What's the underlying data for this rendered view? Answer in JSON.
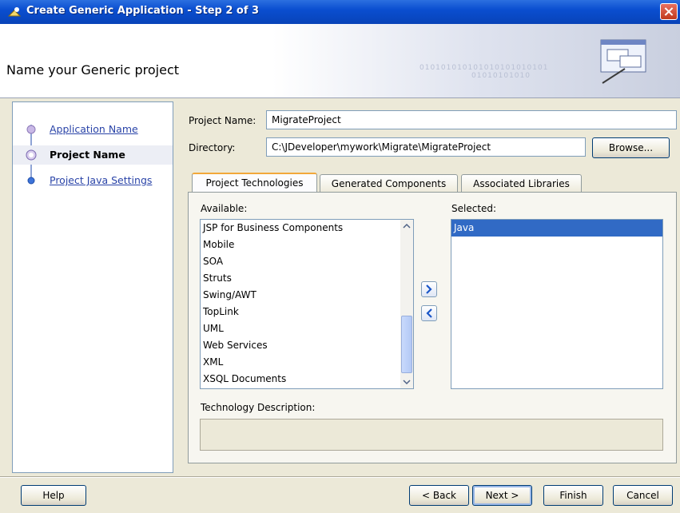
{
  "window": {
    "title": "Create Generic Application - Step 2 of 3"
  },
  "header": {
    "title": "Name your Generic project",
    "binary": "010101010101010101010101",
    "binary2": "01010101010"
  },
  "nav": {
    "items": [
      {
        "label": "Application Name",
        "state": "link"
      },
      {
        "label": "Project Name",
        "state": "current"
      },
      {
        "label": "Project Java Settings",
        "state": "link"
      }
    ]
  },
  "form": {
    "project_name_label": "Project Name:",
    "project_name_value": "MigrateProject",
    "directory_label": "Directory:",
    "directory_value": "C:\\JDeveloper\\mywork\\Migrate\\MigrateProject",
    "browse_label": "Browse..."
  },
  "tabs": [
    {
      "label": "Project Technologies",
      "active": true
    },
    {
      "label": "Generated Components",
      "active": false
    },
    {
      "label": "Associated Libraries",
      "active": false
    }
  ],
  "available": {
    "label": "Available:",
    "items": [
      "JSP for Business Components",
      "Mobile",
      "SOA",
      "Struts",
      "Swing/AWT",
      "TopLink",
      "UML",
      "Web Services",
      "XML",
      "XSQL Documents"
    ]
  },
  "selected": {
    "label": "Selected:",
    "items": [
      "Java"
    ]
  },
  "technology_description": {
    "label": "Technology Description:",
    "value": ""
  },
  "buttons": {
    "help": "Help",
    "back": "< Back",
    "next": "Next >",
    "finish": "Finish",
    "cancel": "Cancel"
  },
  "colors": {
    "titlebar": "#0a4ed0",
    "selection": "#316ac5",
    "link": "#2a44a8"
  }
}
